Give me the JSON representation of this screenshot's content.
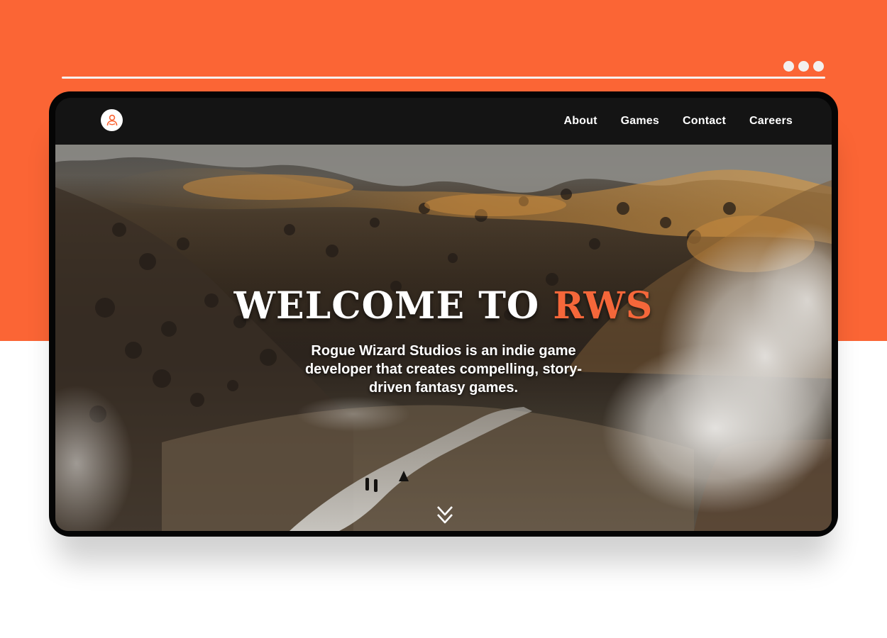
{
  "window": {
    "controls": [
      "dot",
      "dot",
      "dot"
    ]
  },
  "navbar": {
    "logo_icon": "user-icon",
    "links": [
      "About",
      "Games",
      "Contact",
      "Careers"
    ]
  },
  "hero": {
    "title_main": "WELCOME TO ",
    "title_accent": "RWS",
    "subtitle": "Rogue Wizard Studios is an indie game developer that creates compelling, story-driven fantasy games.",
    "scroll_icon": "chevron-double-down-icon"
  },
  "colors": {
    "accent": "#fb6535",
    "navbar": "#141414",
    "frame": "#050505"
  }
}
